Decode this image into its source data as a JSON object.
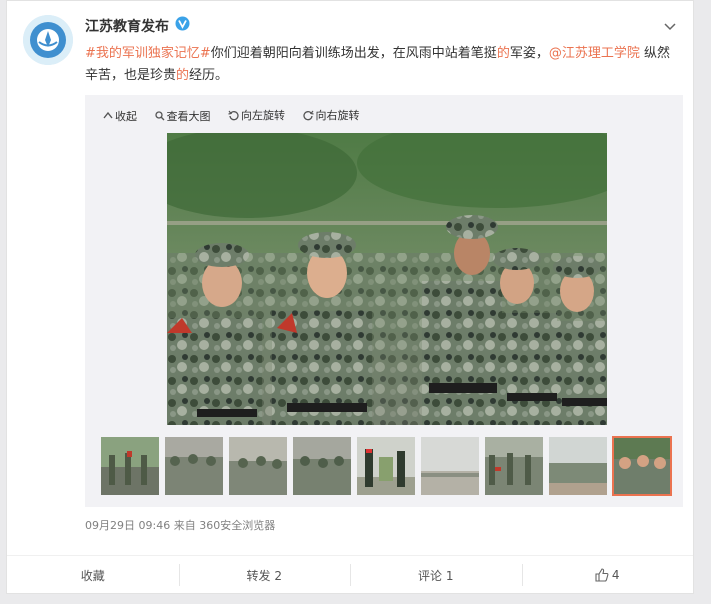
{
  "author": {
    "name": "江苏教育发布",
    "verified_icon": "verified-badge-icon"
  },
  "post": {
    "tag": "#我的军训独家记忆#",
    "text_1": "你们迎着朝阳向着训练场出发，在风雨中站着笔挺",
    "highlight_1": "的",
    "text_2": "军姿，",
    "mention": "@江苏理工学院",
    "text_3": " 纵然辛苦，也是珍贵",
    "highlight_2": "的",
    "text_4": "经历。"
  },
  "toolbar": {
    "collapse": "收起",
    "view_large": "查看大图",
    "rotate_left": "向左旋转",
    "rotate_right": "向右旋转"
  },
  "thumbnails": {
    "count": 9,
    "active_index": 8
  },
  "meta": {
    "time": "09月29日 09:46",
    "from_label": "来自",
    "source": "360安全浏览器"
  },
  "actions": {
    "favorite": "收藏",
    "repost": "转发 2",
    "comment": "评论 1",
    "like_count": "4"
  },
  "colors": {
    "accent": "#eb7350",
    "verified": "#3aa2e8"
  }
}
